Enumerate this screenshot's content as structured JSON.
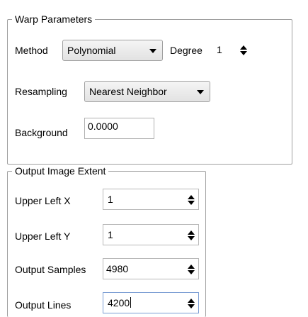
{
  "warp": {
    "title": "Warp Parameters",
    "method_label": "Method",
    "method_value": "Polynomial",
    "degree_label": "Degree",
    "degree_value": "1",
    "resampling_label": "Resampling",
    "resampling_value": "Nearest Neighbor",
    "background_label": "Background",
    "background_value": "0.0000"
  },
  "extent": {
    "title": "Output Image Extent",
    "upper_left_x_label": "Upper Left X",
    "upper_left_x_value": "1",
    "upper_left_y_label": "Upper Left Y",
    "upper_left_y_value": "1",
    "output_samples_label": "Output Samples",
    "output_samples_value": "4980",
    "output_lines_label": "Output Lines",
    "output_lines_value": "4200"
  },
  "icons": {
    "dropdown": "chevron-down-icon",
    "spinner": "spin-arrows-icon"
  }
}
